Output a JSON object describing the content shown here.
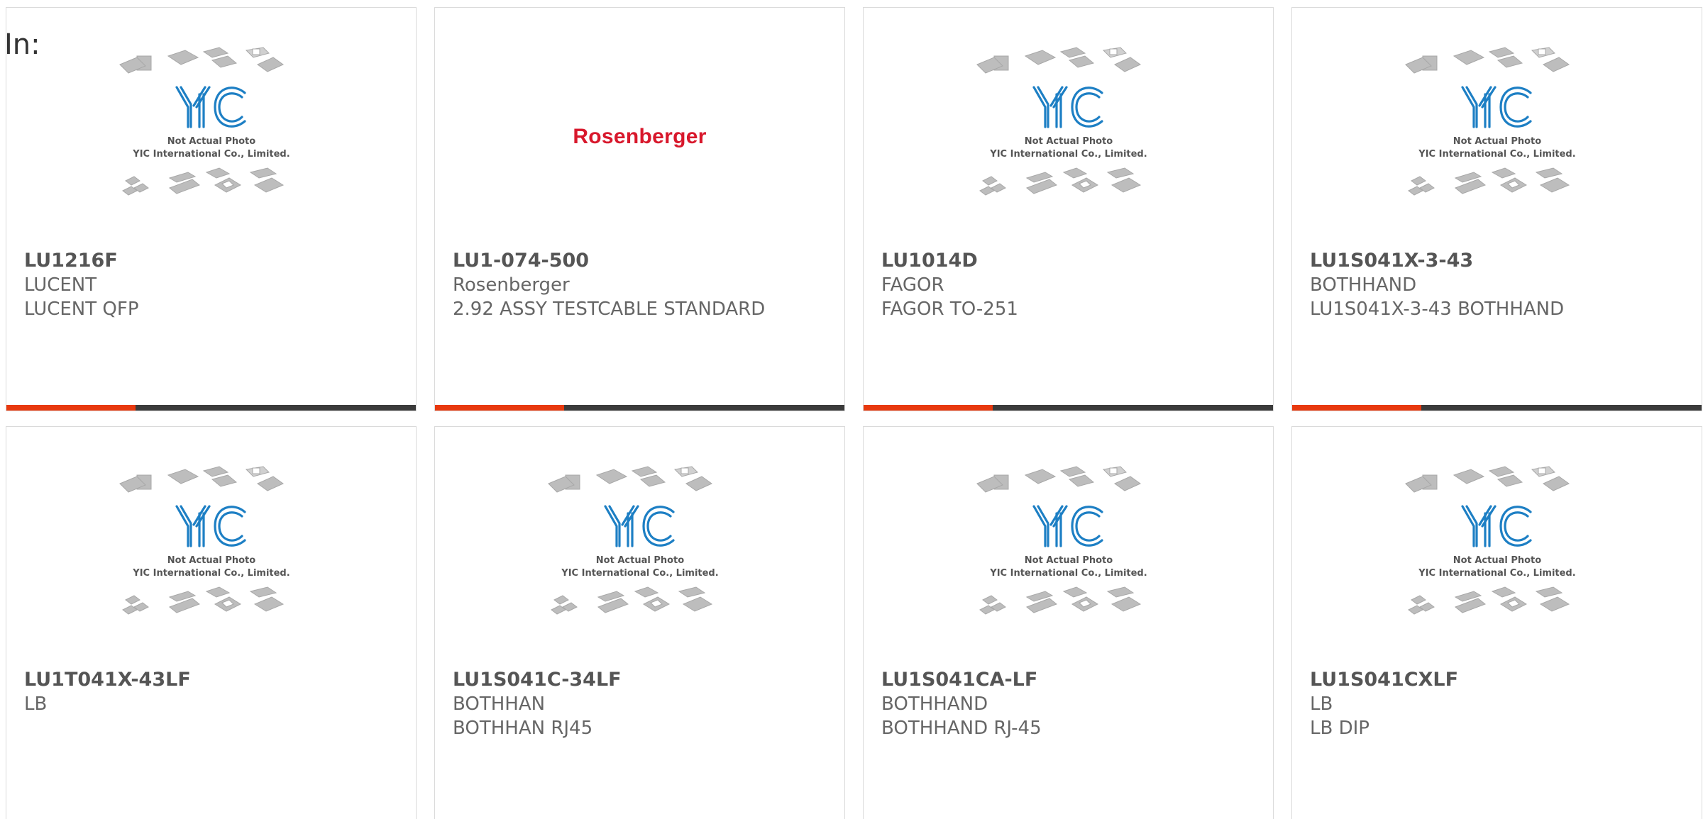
{
  "filter_label": "In:",
  "placeholder": {
    "line1": "Not Actual Photo",
    "line2": "YIC International Co., Limited."
  },
  "colors": {
    "accent": "#e8390e",
    "bar": "#3b3b3b",
    "logo_blue": "#1d7fc4",
    "brand_red": "#d8182c"
  },
  "products": [
    {
      "part": "LU1216F",
      "manufacturer": "LUCENT",
      "description": "LUCENT QFP",
      "image": "placeholder",
      "has_bar": true
    },
    {
      "part": "LU1-074-500",
      "manufacturer": "Rosenberger",
      "description": "2.92 ASSY TESTCABLE STANDARD",
      "image": "brand-logo",
      "brand_text": "Rosenberger",
      "has_bar": true
    },
    {
      "part": "LU1014D",
      "manufacturer": "FAGOR",
      "description": "FAGOR TO-251",
      "image": "placeholder",
      "has_bar": true
    },
    {
      "part": "LU1S041X-3-43",
      "manufacturer": "BOTHHAND",
      "description": "LU1S041X-3-43 BOTHHAND",
      "image": "placeholder",
      "has_bar": true
    },
    {
      "part": "LU1T041X-43LF",
      "manufacturer": "LB",
      "description": "",
      "image": "placeholder",
      "has_bar": false
    },
    {
      "part": "LU1S041C-34LF",
      "manufacturer": "BOTHHAN",
      "description": "BOTHHAN RJ45",
      "image": "placeholder",
      "has_bar": false
    },
    {
      "part": "LU1S041CA-LF",
      "manufacturer": "BOTHHAND",
      "description": "BOTHHAND RJ-45",
      "image": "placeholder",
      "has_bar": false
    },
    {
      "part": "LU1S041CXLF",
      "manufacturer": "LB",
      "description": "LB DIP",
      "image": "placeholder",
      "has_bar": false
    }
  ]
}
